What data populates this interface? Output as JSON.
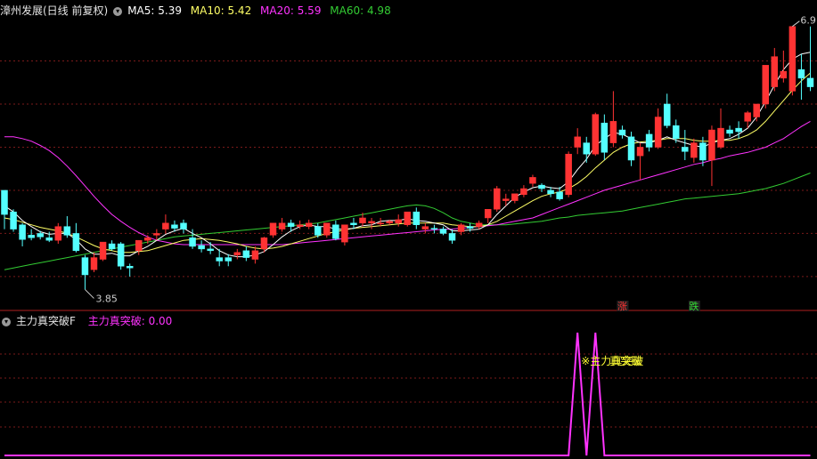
{
  "header": {
    "title": "漳州发展(日线 前复权)",
    "ma5_label": "MA5: 5.39",
    "ma10_label": "MA10: 5.42",
    "ma20_label": "MA20: 5.59",
    "ma60_label": "MA60: 4.98"
  },
  "indicator_header": {
    "name": "主力真突破F",
    "value_label": "主力真突破: 0.00"
  },
  "annotations": {
    "low_price": "3.85",
    "high_price": "6.9",
    "up_marker": "涨",
    "down_marker": "跌",
    "signal_text_a": "※主力真突破",
    "signal_text_b": "真突破"
  },
  "colors": {
    "up": "#ff3333",
    "down": "#54ffff",
    "ma5": "#ffffff",
    "ma10": "#ffff66",
    "ma20": "#ff33ff",
    "ma60": "#33cc33",
    "grid": "#7a1a1a",
    "signal": "#ff33ff"
  },
  "chart_data": [
    {
      "type": "candlestick",
      "title": "漳州发展(日线 前复权)",
      "ylim": [
        3.7,
        7.0
      ],
      "candles": [
        [
          5.0,
          4.98,
          4.72,
          4.55
        ],
        [
          4.75,
          4.78,
          4.55,
          4.52
        ],
        [
          4.6,
          4.62,
          4.43,
          4.35
        ],
        [
          4.48,
          4.55,
          4.45,
          4.42
        ],
        [
          4.5,
          4.53,
          4.46,
          4.43
        ],
        [
          4.45,
          4.52,
          4.42,
          4.4
        ],
        [
          4.42,
          4.62,
          4.58,
          4.38
        ],
        [
          4.58,
          4.7,
          4.48,
          4.45
        ],
        [
          4.5,
          4.62,
          4.3,
          4.28
        ],
        [
          4.22,
          4.25,
          4.02,
          3.85
        ],
        [
          4.08,
          4.28,
          4.22,
          4.05
        ],
        [
          4.2,
          4.38,
          4.4,
          4.18
        ],
        [
          4.38,
          4.42,
          4.32,
          4.3
        ],
        [
          4.38,
          4.4,
          4.12,
          4.08
        ],
        [
          4.12,
          4.15,
          4.1,
          4.0
        ],
        [
          4.3,
          4.36,
          4.42,
          4.25
        ],
        [
          4.42,
          4.48,
          4.45,
          4.38
        ],
        [
          4.48,
          4.55,
          4.5,
          4.42
        ],
        [
          4.55,
          4.72,
          4.62,
          4.5
        ],
        [
          4.6,
          4.65,
          4.56,
          4.52
        ],
        [
          4.62,
          4.66,
          4.55,
          4.5
        ],
        [
          4.45,
          4.55,
          4.35,
          4.32
        ],
        [
          4.36,
          4.42,
          4.32,
          4.28
        ],
        [
          4.32,
          4.4,
          4.3,
          4.26
        ],
        [
          4.22,
          4.32,
          4.18,
          4.12
        ],
        [
          4.22,
          4.26,
          4.18,
          4.12
        ],
        [
          4.25,
          4.32,
          4.28,
          4.2
        ],
        [
          4.3,
          4.35,
          4.22,
          4.18
        ],
        [
          4.2,
          4.35,
          4.3,
          4.15
        ],
        [
          4.32,
          4.46,
          4.45,
          4.28
        ],
        [
          4.48,
          4.6,
          4.62,
          4.45
        ],
        [
          4.55,
          4.68,
          4.62,
          4.52
        ],
        [
          4.62,
          4.66,
          4.58,
          4.52
        ],
        [
          4.58,
          4.65,
          4.6,
          4.55
        ],
        [
          4.58,
          4.66,
          4.62,
          4.55
        ],
        [
          4.58,
          4.62,
          4.48,
          4.45
        ],
        [
          4.48,
          4.6,
          4.62,
          4.45
        ],
        [
          4.6,
          4.65,
          4.44,
          4.42
        ],
        [
          4.4,
          4.56,
          4.6,
          4.36
        ],
        [
          4.62,
          4.68,
          4.6,
          4.55
        ],
        [
          4.62,
          4.74,
          4.68,
          4.58
        ],
        [
          4.62,
          4.68,
          4.64,
          4.55
        ],
        [
          4.62,
          4.68,
          4.62,
          4.58
        ],
        [
          4.62,
          4.66,
          4.64,
          4.6
        ],
        [
          4.62,
          4.72,
          4.66,
          4.58
        ],
        [
          4.6,
          4.72,
          4.75,
          4.58
        ],
        [
          4.75,
          4.8,
          4.6,
          4.55
        ],
        [
          4.55,
          4.62,
          4.58,
          4.5
        ],
        [
          4.56,
          4.6,
          4.55,
          4.5
        ],
        [
          4.55,
          4.58,
          4.5,
          4.48
        ],
        [
          4.5,
          4.55,
          4.42,
          4.38
        ],
        [
          4.52,
          4.62,
          4.6,
          4.48
        ],
        [
          4.58,
          4.62,
          4.56,
          4.52
        ],
        [
          4.58,
          4.65,
          4.62,
          4.55
        ],
        [
          4.68,
          4.75,
          4.78,
          4.62
        ],
        [
          4.78,
          5.05,
          5.02,
          4.75
        ],
        [
          4.88,
          4.96,
          4.9,
          4.82
        ],
        [
          4.88,
          4.96,
          4.96,
          4.85
        ],
        [
          4.95,
          5.06,
          5.02,
          4.92
        ],
        [
          5.08,
          5.18,
          5.15,
          5.04
        ],
        [
          5.06,
          5.08,
          5.02,
          4.98
        ],
        [
          5.0,
          5.04,
          4.96,
          4.92
        ],
        [
          4.98,
          5.04,
          4.9,
          4.88
        ],
        [
          4.95,
          5.45,
          5.42,
          4.92
        ],
        [
          5.5,
          5.72,
          5.62,
          5.42
        ],
        [
          5.55,
          5.62,
          5.42,
          5.32
        ],
        [
          5.42,
          5.9,
          5.88,
          5.4
        ],
        [
          5.78,
          5.88,
          5.44,
          5.35
        ],
        [
          5.55,
          6.15,
          5.8,
          5.5
        ],
        [
          5.7,
          5.75,
          5.64,
          5.6
        ],
        [
          5.62,
          5.68,
          5.35,
          5.28
        ],
        [
          5.4,
          5.55,
          5.5,
          5.12
        ],
        [
          5.65,
          5.7,
          5.5,
          5.45
        ],
        [
          5.5,
          5.95,
          5.85,
          5.48
        ],
        [
          6.0,
          6.12,
          5.75,
          5.72
        ],
        [
          5.75,
          5.82,
          5.6,
          5.55
        ],
        [
          5.5,
          5.7,
          5.45,
          5.35
        ],
        [
          5.38,
          5.6,
          5.55,
          5.32
        ],
        [
          5.55,
          5.62,
          5.35,
          5.28
        ],
        [
          5.35,
          5.75,
          5.7,
          5.05
        ],
        [
          5.5,
          5.95,
          5.72,
          5.48
        ],
        [
          5.7,
          5.75,
          5.66,
          5.62
        ],
        [
          5.72,
          5.8,
          5.68,
          5.6
        ],
        [
          5.8,
          5.92,
          5.9,
          5.72
        ],
        [
          5.85,
          6.0,
          6.0,
          5.8
        ],
        [
          6.0,
          6.45,
          6.45,
          5.95
        ],
        [
          6.2,
          6.65,
          6.55,
          6.15
        ],
        [
          6.3,
          6.62,
          6.38,
          6.25
        ],
        [
          6.15,
          6.9,
          6.9,
          6.1
        ],
        [
          6.4,
          6.58,
          6.3,
          6.05
        ],
        [
          6.3,
          6.9,
          6.2,
          6.15
        ]
      ],
      "ma5": [
        4.82,
        4.75,
        4.65,
        4.58,
        4.52,
        4.49,
        4.5,
        4.5,
        4.43,
        4.32,
        4.26,
        4.26,
        4.27,
        4.24,
        4.24,
        4.3,
        4.35,
        4.42,
        4.49,
        4.53,
        4.56,
        4.5,
        4.45,
        4.38,
        4.3,
        4.25,
        4.23,
        4.23,
        4.25,
        4.29,
        4.37,
        4.46,
        4.53,
        4.58,
        4.6,
        4.58,
        4.58,
        4.55,
        4.55,
        4.56,
        4.59,
        4.6,
        4.64,
        4.65,
        4.65,
        4.67,
        4.65,
        4.64,
        4.62,
        4.6,
        4.53,
        4.53,
        4.54,
        4.55,
        4.6,
        4.72,
        4.82,
        4.92,
        4.98,
        5.03,
        5.05,
        5.03,
        5.02,
        5.1,
        5.24,
        5.36,
        5.52,
        5.6,
        5.67,
        5.65,
        5.6,
        5.55,
        5.55,
        5.58,
        5.62,
        5.58,
        5.55,
        5.52,
        5.5,
        5.55,
        5.58,
        5.6,
        5.65,
        5.72,
        5.85,
        6.03,
        6.22,
        6.4,
        6.52,
        6.58,
        6.6
      ],
      "ma10": [
        4.68,
        4.66,
        4.63,
        4.6,
        4.57,
        4.55,
        4.53,
        4.5,
        4.46,
        4.41,
        4.36,
        4.32,
        4.3,
        4.28,
        4.28,
        4.29,
        4.3,
        4.33,
        4.36,
        4.39,
        4.42,
        4.43,
        4.44,
        4.43,
        4.42,
        4.4,
        4.38,
        4.35,
        4.33,
        4.32,
        4.33,
        4.35,
        4.38,
        4.41,
        4.44,
        4.47,
        4.5,
        4.52,
        4.54,
        4.56,
        4.57,
        4.58,
        4.59,
        4.6,
        4.61,
        4.62,
        4.62,
        4.62,
        4.62,
        4.62,
        4.6,
        4.59,
        4.58,
        4.58,
        4.6,
        4.64,
        4.7,
        4.76,
        4.82,
        4.88,
        4.93,
        4.96,
        4.98,
        5.02,
        5.08,
        5.16,
        5.26,
        5.35,
        5.44,
        5.5,
        5.54,
        5.56,
        5.57,
        5.58,
        5.6,
        5.6,
        5.6,
        5.58,
        5.57,
        5.57,
        5.58,
        5.58,
        5.6,
        5.64,
        5.7,
        5.8,
        5.92,
        6.04,
        6.16,
        6.27,
        6.36
      ],
      "ma20": [
        5.62,
        5.62,
        5.6,
        5.57,
        5.52,
        5.46,
        5.38,
        5.28,
        5.17,
        5.05,
        4.93,
        4.82,
        4.72,
        4.64,
        4.57,
        4.51,
        4.46,
        4.42,
        4.4,
        4.38,
        4.37,
        4.37,
        4.37,
        4.37,
        4.37,
        4.37,
        4.37,
        4.37,
        4.37,
        4.37,
        4.37,
        4.37,
        4.38,
        4.39,
        4.4,
        4.41,
        4.42,
        4.43,
        4.44,
        4.45,
        4.46,
        4.47,
        4.48,
        4.49,
        4.5,
        4.51,
        4.52,
        4.53,
        4.54,
        4.55,
        4.55,
        4.56,
        4.57,
        4.58,
        4.59,
        4.6,
        4.62,
        4.64,
        4.66,
        4.68,
        4.72,
        4.76,
        4.8,
        4.84,
        4.88,
        4.92,
        4.96,
        5.0,
        5.03,
        5.06,
        5.09,
        5.12,
        5.15,
        5.18,
        5.21,
        5.24,
        5.27,
        5.3,
        5.32,
        5.35,
        5.37,
        5.4,
        5.42,
        5.44,
        5.47,
        5.5,
        5.55,
        5.6,
        5.67,
        5.74,
        5.8
      ],
      "ma60": [
        4.08,
        4.1,
        4.12,
        4.14,
        4.16,
        4.18,
        4.2,
        4.22,
        4.24,
        4.26,
        4.28,
        4.3,
        4.32,
        4.34,
        4.36,
        4.38,
        4.4,
        4.42,
        4.44,
        4.46,
        4.47,
        4.48,
        4.49,
        4.5,
        4.51,
        4.52,
        4.53,
        4.54,
        4.55,
        4.56,
        4.57,
        4.58,
        4.59,
        4.6,
        4.61,
        4.62,
        4.64,
        4.66,
        4.68,
        4.7,
        4.72,
        4.74,
        4.76,
        4.78,
        4.8,
        4.82,
        4.83,
        4.82,
        4.79,
        4.74,
        4.68,
        4.64,
        4.62,
        4.6,
        4.6,
        4.6,
        4.6,
        4.61,
        4.62,
        4.63,
        4.64,
        4.66,
        4.68,
        4.69,
        4.71,
        4.72,
        4.73,
        4.74,
        4.75,
        4.76,
        4.78,
        4.8,
        4.82,
        4.84,
        4.86,
        4.88,
        4.9,
        4.91,
        4.92,
        4.93,
        4.94,
        4.95,
        4.96,
        4.98,
        5.0,
        5.02,
        5.05,
        5.08,
        5.12,
        5.16,
        5.2
      ]
    },
    {
      "type": "line",
      "title": "主力真突破F",
      "ylim": [
        0,
        1
      ],
      "values": [
        0,
        0,
        0,
        0,
        0,
        0,
        0,
        0,
        0,
        0,
        0,
        0,
        0,
        0,
        0,
        0,
        0,
        0,
        0,
        0,
        0,
        0,
        0,
        0,
        0,
        0,
        0,
        0,
        0,
        0,
        0,
        0,
        0,
        0,
        0,
        0,
        0,
        0,
        0,
        0,
        0,
        0,
        0,
        0,
        0,
        0,
        0,
        0,
        0,
        0,
        0,
        0,
        0,
        0,
        0,
        0,
        0,
        0,
        0,
        0,
        0,
        0,
        0,
        0,
        1,
        0,
        1,
        0,
        0,
        0,
        0,
        0,
        0,
        0,
        0,
        0,
        0,
        0,
        0,
        0,
        0,
        0,
        0,
        0,
        0,
        0,
        0,
        0,
        0,
        0,
        0
      ]
    }
  ]
}
